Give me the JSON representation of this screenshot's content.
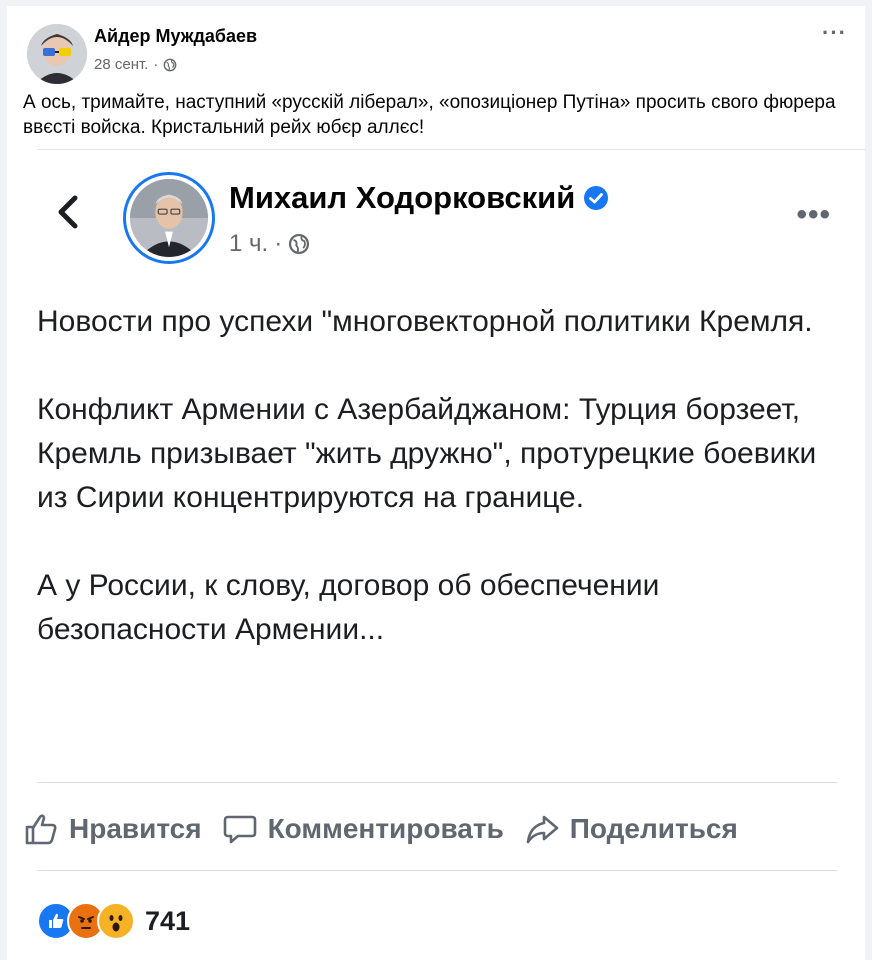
{
  "outer_post": {
    "author": "Айдер Муждабаев",
    "date": "28 сент.",
    "separator": "·",
    "text": "А ось, тримайте, наступний «русскій ліберал», «опозиціонер Путіна» просить свого фюрера ввєсті войска. Кристальний рейх юбєр аллєс!",
    "icons": {
      "more": "more-icon",
      "privacy": "globe-icon"
    }
  },
  "inner_post": {
    "author": "Михаил Ходорковский",
    "time": "1 ч.",
    "separator": "·",
    "paragraphs": [
      "Новости про успехи \"многовекторной политики Кремля.",
      "Конфликт Армении с Азербайджаном: Турция борзеет, Кремль призывает \"жить дружно\", протурецкие боевики из Сирии концентрируются на границе.",
      "А у России, к слову, договор об обеспечении безопасности Армении..."
    ],
    "actions": {
      "like": "Нравится",
      "comment": "Комментировать",
      "share": "Поделиться"
    },
    "reactions": {
      "types": [
        "like",
        "angry",
        "wow"
      ],
      "count": "741"
    }
  },
  "colors": {
    "accent": "#1877f2",
    "secondary_text": "#65676b",
    "angry": "#e9710f",
    "wow": "#f7b125"
  }
}
